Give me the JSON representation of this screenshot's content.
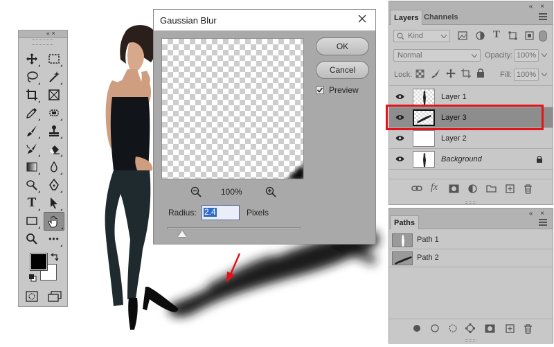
{
  "colors": {
    "panel_bg": "#c8c8c8",
    "dialog_bg": "#a9a9a9",
    "selected_layer": "#8d8d8d",
    "highlight_box": "#e0141a",
    "annotation_arrow": "#e0141a",
    "selection_text": "#2f6ac7"
  },
  "tools": {
    "header_controls": "«   ×",
    "items": [
      {
        "icon": "move-icon"
      },
      {
        "icon": "marquee-icon"
      },
      {
        "icon": "lasso-icon"
      },
      {
        "icon": "magic-wand-icon"
      },
      {
        "icon": "crop-icon"
      },
      {
        "icon": "frame-icon"
      },
      {
        "icon": "eyedropper-icon"
      },
      {
        "icon": "spot-healing-icon"
      },
      {
        "icon": "brush-icon"
      },
      {
        "icon": "clone-stamp-icon"
      },
      {
        "icon": "history-brush-icon"
      },
      {
        "icon": "eraser-icon"
      },
      {
        "icon": "gradient-icon"
      },
      {
        "icon": "blur-icon"
      },
      {
        "icon": "dodge-icon"
      },
      {
        "icon": "pen-icon"
      },
      {
        "icon": "type-icon",
        "glyph": "T"
      },
      {
        "icon": "path-selection-icon"
      },
      {
        "icon": "rectangle-icon"
      },
      {
        "icon": "hand-icon",
        "active": true
      },
      {
        "icon": "zoom-icon"
      },
      {
        "icon": "more-tools-icon",
        "glyph": "•••"
      }
    ]
  },
  "dialog": {
    "title": "Gaussian Blur",
    "ok_label": "OK",
    "cancel_label": "Cancel",
    "preview_label": "Preview",
    "preview_checked": true,
    "zoom_value": "100%",
    "radius_label": "Radius:",
    "radius_value": "2.4",
    "radius_unit": "Pixels"
  },
  "layers_panel": {
    "tabs": [
      "Layers",
      "Channels"
    ],
    "panel_controls": "«  ×",
    "filter_kind": "Kind",
    "blend_mode": "Normal",
    "opacity_label": "Opacity:",
    "opacity_value": "100%",
    "lock_label": "Lock:",
    "fill_label": "Fill:",
    "fill_value": "100%",
    "layers": [
      {
        "name": "Layer 1",
        "visible": true,
        "selected": false
      },
      {
        "name": "Layer 3",
        "visible": true,
        "selected": true
      },
      {
        "name": "Layer 2",
        "visible": true,
        "selected": false
      },
      {
        "name": "Background",
        "visible": true,
        "selected": false,
        "locked": true
      }
    ]
  },
  "paths_panel": {
    "tab": "Paths",
    "panel_controls": "«  ×",
    "paths": [
      {
        "name": "Path 1"
      },
      {
        "name": "Path 2"
      }
    ]
  }
}
